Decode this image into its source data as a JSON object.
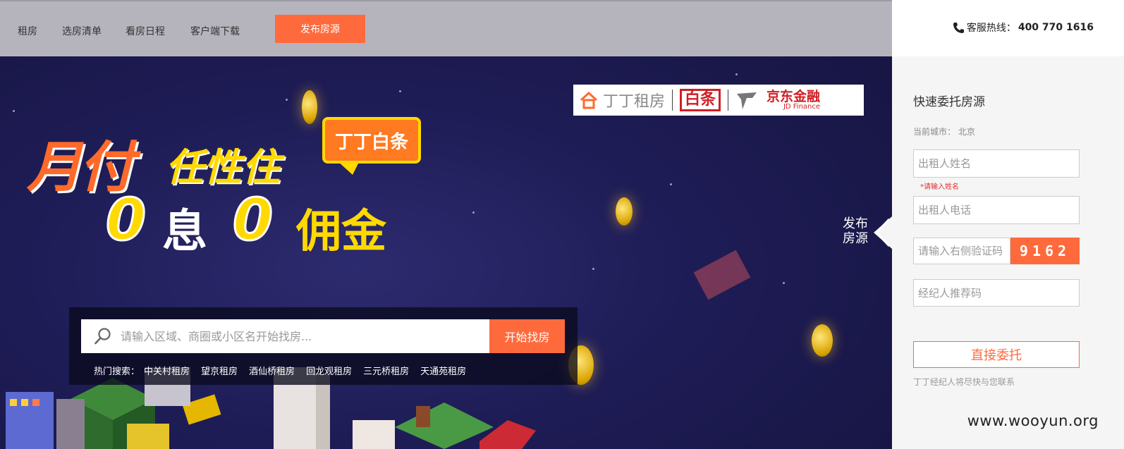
{
  "nav": {
    "items": [
      "租房",
      "选房清单",
      "看房日程",
      "客户端下载"
    ],
    "publish": "发布房源"
  },
  "brands": {
    "ding": "丁丁租房",
    "baitiao": "白条",
    "jd_cn": "京东金融",
    "jd_en": "JD Finance"
  },
  "hero": {
    "line1_a": "月付",
    "line1_b": "任性住",
    "bubble": "丁丁白条",
    "zero": "0",
    "xi": "息",
    "yongjin": "佣金"
  },
  "search": {
    "placeholder": "请输入区域、商圈或小区名开始找房...",
    "button": "开始找房",
    "hot_label": "热门搜索：",
    "hot": [
      "中关村租房",
      "望京租房",
      "酒仙桥租房",
      "回龙观租房",
      "三元桥租房",
      "天通苑租房"
    ]
  },
  "side_tab": {
    "line1": "发布",
    "line2": "房源"
  },
  "hotline": {
    "label": "客服热线：",
    "number": "400 770 1616"
  },
  "form": {
    "title": "快速委托房源",
    "city_label": "当前城市：",
    "city": "北京",
    "name_placeholder": "出租人姓名",
    "name_error": "*请输入姓名",
    "phone_placeholder": "出租人电话",
    "captcha_placeholder": "请输入右侧验证码",
    "captcha_code": "9162",
    "referral_placeholder": "经纪人推荐码",
    "submit": "直接委托",
    "note": "丁丁经纪人将尽快与您联系"
  },
  "watermark": "www.wooyun.org",
  "colors": {
    "accent": "#ff6a3d",
    "yellow": "#ffd900",
    "navy": "#1e1c55"
  }
}
